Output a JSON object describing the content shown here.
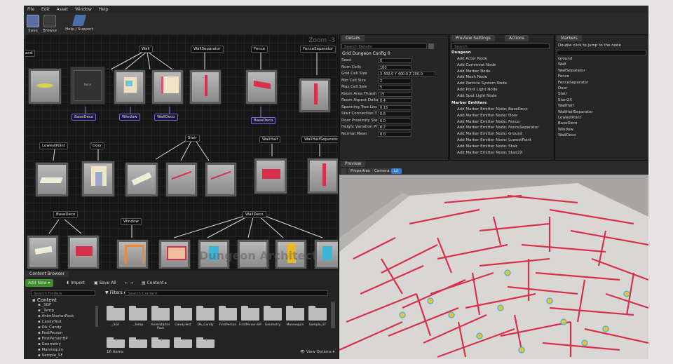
{
  "menu": [
    "File",
    "Edit",
    "Asset",
    "Window",
    "Help"
  ],
  "toolbar": {
    "save": "Save",
    "browse": "Browse",
    "help": "Help / Support"
  },
  "graph": {
    "zoom": "Zoom -3",
    "labels": {
      "land": "and",
      "wall": "Wall",
      "wallseparator": "WallSeparator",
      "fence": "Fence",
      "fenceseparator": "FenceSeparator",
      "lowestpoint": "LowestPoint",
      "door": "Door",
      "stair": "Stair",
      "wallhalf": "WallHalf",
      "wallhalfseparator": "WallHalfSeparator",
      "basedeco": "BaseDeco",
      "window": "Window",
      "walldeco": "WallDeco"
    },
    "blue_labels": {
      "basedeco1": "BaseDeco",
      "window1": "Window",
      "walldeco1": "WallDeco",
      "basedeco2": "BaseDeco"
    },
    "node_text": "None",
    "watermark": "Dungeon Architect"
  },
  "details": {
    "tab": "Details",
    "search_placeholder": "Search Details",
    "title": "Grid Dungeon Config 0",
    "rows": [
      {
        "label": "Seed",
        "value": "0"
      },
      {
        "label": "Num Cells",
        "value": "100"
      },
      {
        "label": "Grid Cell Size",
        "value": "X 400.0  Y 400.0  Z 200.0"
      },
      {
        "label": "Min Cell Size",
        "value": "2"
      },
      {
        "label": "Max Cell Size",
        "value": "5"
      },
      {
        "label": "Room Area Thresh",
        "value": "15"
      },
      {
        "label": "Room Aspect Delta",
        "value": "0.4"
      },
      {
        "label": "Spanning Tree Loo",
        "value": "0.15"
      },
      {
        "label": "Stair Connection T",
        "value": "0.8"
      },
      {
        "label": "Door Proximity Ste",
        "value": "6.0"
      },
      {
        "label": "Height Variation Pr",
        "value": "0.2"
      },
      {
        "label": "Normal Mean",
        "value": "0.0"
      }
    ]
  },
  "actions": {
    "tabs": [
      "Preview Settings",
      "Actions"
    ],
    "search_placeholder": "Search",
    "group1": "Dungeon",
    "items1": [
      "Add Actor Node",
      "Add Comment Node",
      "Add Marker Node",
      "Add Mesh Node",
      "Add Particle System Node",
      "Add Point Light Node",
      "Add Spot Light Node"
    ],
    "group2": "Marker Emitters",
    "items2": [
      "Add Marker Emitter Node: BaseDeco",
      "Add Marker Emitter Node: Door",
      "Add Marker Emitter Node: Fence",
      "Add Marker Emitter Node: FenceSeparator",
      "Add Marker Emitter Node: Ground",
      "Add Marker Emitter Node: LowestPoint",
      "Add Marker Emitter Node: Stair",
      "Add Marker Emitter Node: Stair2X"
    ]
  },
  "markers": {
    "tab": "Markers",
    "hint": "Double click to jump to the node",
    "items": [
      "Ground",
      "Wall",
      "WallSeparator",
      "Fence",
      "FenceSeparator",
      "Door",
      "Stair",
      "Stair2X",
      "WallHalf",
      "WallHalfSeparator",
      "LowestPoint",
      "BaseDeco",
      "Window",
      "WallDeco"
    ]
  },
  "preview": {
    "tab": "Preview",
    "buttons": [
      "Properties",
      "Camera",
      "Lit"
    ]
  },
  "content_browser": {
    "tab": "Content Browser",
    "add_new": "Add New",
    "import": "Import",
    "save_all": "Save All",
    "path": "Content",
    "search_folders": "Search Folders",
    "filters": "Filters",
    "search_content": "Search Content",
    "tree": [
      "Content",
      "_SGF",
      "_Temp",
      "AnimStarterPack",
      "CandyTest",
      "DA_Candy",
      "FestPerson",
      "FirstPersonBP",
      "Geometry",
      "Mannequin",
      "Sample_SF"
    ],
    "folders": [
      "_SGF",
      "_Temp",
      "AnimStarter Pack",
      "CandyTest",
      "DA_Candy",
      "FirstPerson",
      "FirstPerson BP",
      "Geometry",
      "Mannequin",
      "Sample_SF"
    ],
    "count": "16 items",
    "view_options": "View Options"
  },
  "colors": {
    "accent": "#3b79c9",
    "add_new": "#3c8e2b",
    "wall_red": "#d7304c",
    "blue_pin": "#7d6ad0"
  }
}
